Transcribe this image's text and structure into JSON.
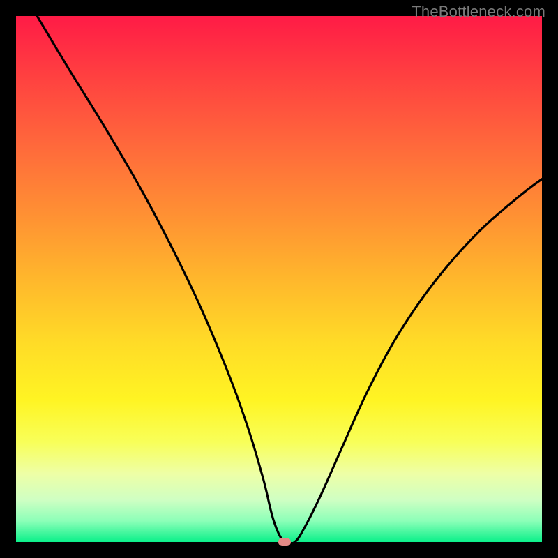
{
  "watermark": "TheBottleneck.com",
  "chart_data": {
    "type": "line",
    "title": "",
    "xlabel": "",
    "ylabel": "",
    "xlim": [
      0,
      100
    ],
    "ylim": [
      0,
      100
    ],
    "grid": false,
    "marker": {
      "x": 51,
      "y": 0,
      "color": "#e58a86"
    },
    "annotations": [
      {
        "text": "TheBottleneck.com",
        "position": "top-right",
        "color": "#7a7a7a"
      }
    ],
    "series": [
      {
        "name": "bottleneck-curve",
        "color": "#000000",
        "x": [
          4,
          10,
          18,
          26,
          34,
          40,
          44,
          47,
          49,
          51,
          53,
          55,
          58,
          62,
          67,
          73,
          80,
          88,
          96,
          100
        ],
        "y": [
          100,
          90,
          77,
          63,
          47,
          33,
          22,
          12,
          4,
          0,
          0,
          3,
          9,
          18,
          29,
          40,
          50,
          59,
          66,
          69
        ]
      }
    ],
    "background_gradient": {
      "type": "vertical",
      "stops": [
        {
          "pos": 0.0,
          "color": "#ff1b46"
        },
        {
          "pos": 0.12,
          "color": "#ff4240"
        },
        {
          "pos": 0.25,
          "color": "#ff6a3b"
        },
        {
          "pos": 0.38,
          "color": "#ff9133"
        },
        {
          "pos": 0.5,
          "color": "#ffb72c"
        },
        {
          "pos": 0.62,
          "color": "#ffdb27"
        },
        {
          "pos": 0.73,
          "color": "#fff423"
        },
        {
          "pos": 0.81,
          "color": "#f8ff59"
        },
        {
          "pos": 0.87,
          "color": "#eeffa6"
        },
        {
          "pos": 0.92,
          "color": "#cfffc3"
        },
        {
          "pos": 0.96,
          "color": "#8cffb8"
        },
        {
          "pos": 1.0,
          "color": "#0bf08a"
        }
      ]
    }
  }
}
